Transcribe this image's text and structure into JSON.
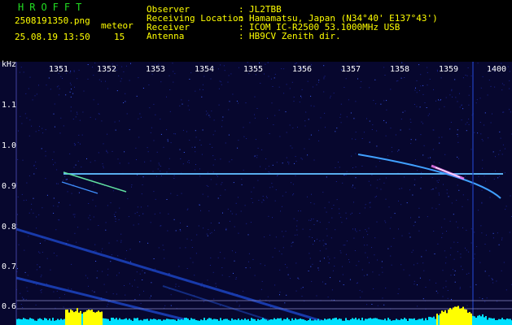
{
  "header": {
    "app_name": "HROFFT",
    "filename": "2508191350.png",
    "meteor_label": "meteor",
    "datetime": "25.08.19 13:50",
    "meteor_count": "15",
    "fields": [
      {
        "label": "Observer",
        "sep": ":",
        "value": "JL2TBB"
      },
      {
        "label": "Receiving Location",
        "sep": ":",
        "value": "Hamamatsu, Japan (N34°40' E137°43')"
      },
      {
        "label": "Receiver",
        "sep": ":",
        "value": "ICOM IC-R2500 53.1000MHz USB"
      },
      {
        "label": "Antenna",
        "sep": ":",
        "value": "HB9CV Zenith dir."
      }
    ]
  },
  "plot": {
    "y_unit": "kHz",
    "x_ticks": [
      "1351",
      "1352",
      "1353",
      "1354",
      "1355",
      "1356",
      "1357",
      "1358",
      "1359",
      "1400"
    ],
    "y_ticks": [
      "1.1",
      "1.0",
      "0.9",
      "0.8",
      "0.7",
      "0.6"
    ],
    "colors": {
      "background": "#0a0a3a",
      "noise": "#2030c0",
      "trace": "#60c0ff",
      "hot": "#ffffff",
      "spectrum": "#00e0ff",
      "peak": "#ffff00"
    }
  }
}
